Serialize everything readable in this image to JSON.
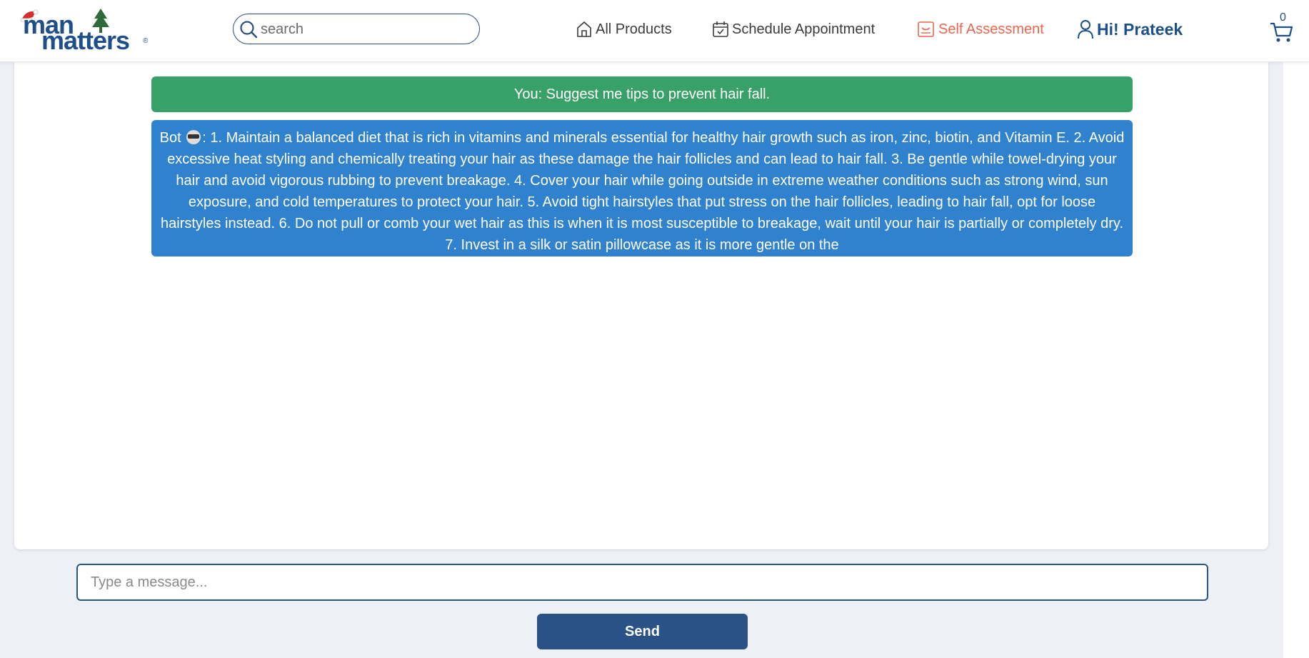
{
  "brand": {
    "logo_line1": "man",
    "logo_line2": "matters",
    "logo_reg": "®",
    "primary_color": "#1f4f8a",
    "accent_color": "#e8674e"
  },
  "header": {
    "search_placeholder": "search",
    "nav": {
      "all_products": "All Products",
      "schedule": "Schedule Appointment",
      "self_assessment": "Self Assessment",
      "user_greeting": "Hi! Prateek"
    },
    "cart_count": "0"
  },
  "chat": {
    "messages": [
      {
        "sender": "user",
        "text": "You: Suggest me tips to prevent hair fall."
      },
      {
        "sender": "bot",
        "prefix": "Bot",
        "text": ": 1. Maintain a balanced diet that is rich in vitamins and minerals essential for healthy hair growth such as iron, zinc, biotin, and Vitamin E. 2. Avoid excessive heat styling and chemically treating your hair as these damage the hair follicles and can lead to hair fall. 3. Be gentle while towel-drying your hair and avoid vigorous rubbing to prevent breakage. 4. Cover your hair while going outside in extreme weather conditions such as strong wind, sun exposure, and cold temperatures to protect your hair. 5. Avoid tight hairstyles that put stress on the hair follicles, leading to hair fall, opt for loose hairstyles instead. 6. Do not pull or comb your wet hair as this is when it is most susceptible to breakage, wait until your hair is partially or completely dry. 7. Invest in a silk or satin pillowcase as it is more gentle on the"
      }
    ],
    "input_placeholder": "Type a message...",
    "send_label": "Send",
    "user_bubble_color": "#38a169",
    "bot_bubble_color": "#3182ce"
  },
  "icons": {
    "search": "search-icon",
    "home": "home-icon",
    "calendar": "calendar-icon",
    "assessment": "assessment-icon",
    "user": "user-icon",
    "cart": "cart-icon",
    "bot": "bot-emoji-icon"
  }
}
